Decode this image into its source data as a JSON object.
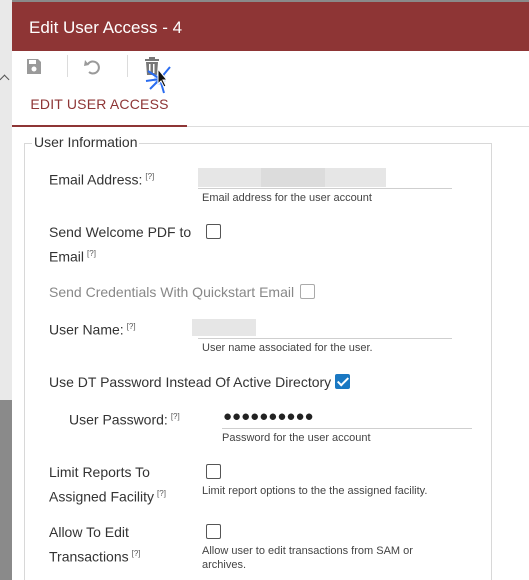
{
  "dialog": {
    "title": "Edit User Access - 4"
  },
  "toolbar": {
    "save_icon": "floppy-disk-icon",
    "undo_icon": "undo-icon",
    "delete_icon": "trash-icon"
  },
  "tabs": [
    {
      "label": "EDIT USER ACCESS",
      "active": true
    }
  ],
  "section": {
    "legend": "User Information"
  },
  "help_marker": "[?]",
  "fields": {
    "email": {
      "label": "Email Address:",
      "value": "",
      "hint": "Email address for the user account"
    },
    "send_welcome": {
      "label_line1": "Send Welcome PDF to",
      "label_line2": "Email",
      "checked": false
    },
    "send_credentials": {
      "label": "Send Credentials With Quickstart Email",
      "checked": false,
      "disabled": true
    },
    "user_name": {
      "label": "User Name:",
      "value": "",
      "hint": "User name associated for the user."
    },
    "use_dt_password": {
      "label": "Use DT Password Instead Of Active Directory",
      "checked": true
    },
    "user_password": {
      "label": "User Password:",
      "value": "●●●●●●●●●●",
      "hint": "Password for the user account"
    },
    "limit_reports": {
      "label_line1": "Limit Reports To",
      "label_line2": "Assigned Facility",
      "checked": false,
      "hint": "Limit report options to the the assigned facility."
    },
    "allow_edit": {
      "label_line1": "Allow To Edit",
      "label_line2": "Transactions",
      "checked": false,
      "hint_line1": "Allow user to edit transactions from SAM or",
      "hint_line2": "archives."
    }
  },
  "colors": {
    "accent": "#8e3535",
    "checkbox_checked": "#1a78c2"
  }
}
